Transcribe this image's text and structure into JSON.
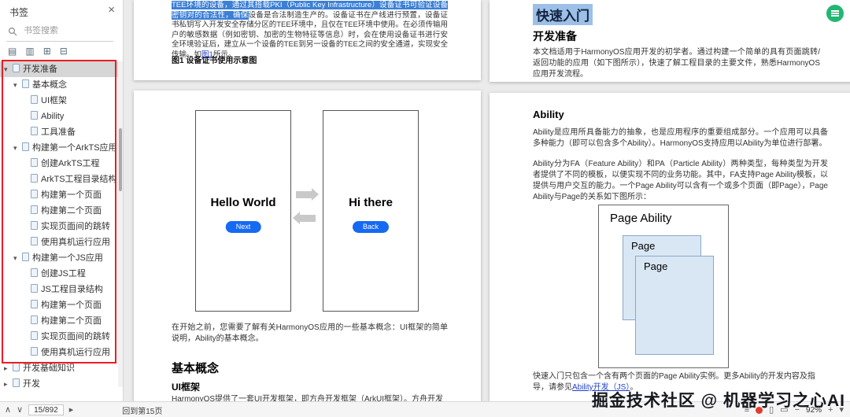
{
  "colors": {
    "accent_blue": "#1669f2",
    "text_selection_dark": "#3b7fd6",
    "text_selection_light": "#9cc0e8",
    "annotation_red": "#ec1c24",
    "plugin_green": "#23b673",
    "link_blue": "#2443c9"
  },
  "icons": {
    "close": "×",
    "caret_expanded": "▾",
    "caret_collapsed": "▸",
    "tool_1": "▤",
    "tool_2": "▥",
    "tool_3": "⊞",
    "tool_4": "⊟",
    "prev_page": "∧",
    "next_page": "∨",
    "go_page": "▸",
    "hand_tool": "≡",
    "single_page": "▯",
    "fit_width": "▭",
    "zoom_out": "−",
    "zoom_in": "+",
    "zoom_menu": "▾"
  },
  "app": {
    "watermark": "掘金技术社区 @ 机器学习之心AI"
  },
  "sidebar": {
    "title": "书签",
    "search_placeholder": "书签搜索",
    "tree": [
      {
        "label": "开发准备"
      },
      {
        "label": "基本概念"
      },
      {
        "label": "UI框架"
      },
      {
        "label": "Ability"
      },
      {
        "label": "工具准备"
      },
      {
        "label": "构建第一个ArkTS应用"
      },
      {
        "label": "创建ArkTS工程"
      },
      {
        "label": "ArkTS工程目录结构"
      },
      {
        "label": "构建第一个页面"
      },
      {
        "label": "构建第二个页面"
      },
      {
        "label": "实现页面间的跳转"
      },
      {
        "label": "使用真机运行应用"
      },
      {
        "label": "构建第一个JS应用"
      },
      {
        "label": "创建JS工程"
      },
      {
        "label": "JS工程目录结构"
      },
      {
        "label": "构建第一个页面"
      },
      {
        "label": "构建第二个页面"
      },
      {
        "label": "实现页面间的跳转"
      },
      {
        "label": "使用真机运行应用"
      },
      {
        "label": "开发基础知识"
      },
      {
        "label": "开发"
      }
    ]
  },
  "pages": {
    "security": {
      "selected_line": "TEE环境的设备，通过其搭载PKI（Public Key Infrastructure）设备证书可验证设备密钥对的合法性，确保",
      "body": "设备是合法制造生产的。设备证书在产线进行预置，设备证书私钥写入开发安全存储分区的TEE环境中，且仅在TEE环境中使用。在必须传输用户的敏感数据（例如密钥、加密的生物特征等信息）时，会在使用设备证书进行安全环境验证后，建立从一个设备的TEE到另一设备的TEE之间的安全通道，实现安全传输。如",
      "link": "图1",
      "body_end": "所示。",
      "caption": "图1 设备证书使用示意图"
    },
    "hello": {
      "phone1_title": "Hello World",
      "phone1_button": "Next",
      "phone2_title": "Hi there",
      "phone2_button": "Back",
      "intro": "在开始之前，您需要了解有关HarmonyOS应用的一些基本概念：UI框架的简单说明，Ability的基本概念。",
      "h1": "基本概念",
      "h2": "UI框架",
      "body": "HarmonyOS提供了一套UI开发框架，即方舟开发框架（ArkUI框架）。方舟开发框架可为开发者提供"
    },
    "quickstart": {
      "title": "快速入门",
      "heading": "开发准备",
      "body": "本文档适用于HarmonyOS应用开发的初学者。通过构建一个简单的具有页面跳转/返回功能的应用（如下图所示），快速了解工程目录的主要文件，熟悉HarmonyOS应用开发流程。"
    },
    "ability": {
      "heading": "Ability",
      "p1": "Ability是应用所具备能力的抽象，也是应用程序的重要组成部分。一个应用可以具备多种能力（即可以包含多个Ability）。HarmonyOS支持应用以Ability为单位进行部署。",
      "p2": "Ability分为FA（Feature Ability）和PA（Particle Ability）两种类型，每种类型为开发者提供了不同的模板，以便实现不同的业务功能。其中，FA支持Page Ability模板，以提供与用户交互的能力。一个Page Ability可以含有一个或多个页面（即Page），Page Ability与Page的关系如下图所示：",
      "diagram": {
        "outer_label": "Page Ability",
        "page1_label": "Page",
        "page2_label": "Page"
      },
      "p3": "快速入门只包含一个含有两个页面的Page Ability实例。更多Ability的开发内容及指导，请参见",
      "p3_link": "Ability开发（JS）",
      "p3_end": "。"
    }
  },
  "statusbar": {
    "page_indicator": "15/892",
    "back_link": "回到第15页",
    "zoom": "92%"
  }
}
